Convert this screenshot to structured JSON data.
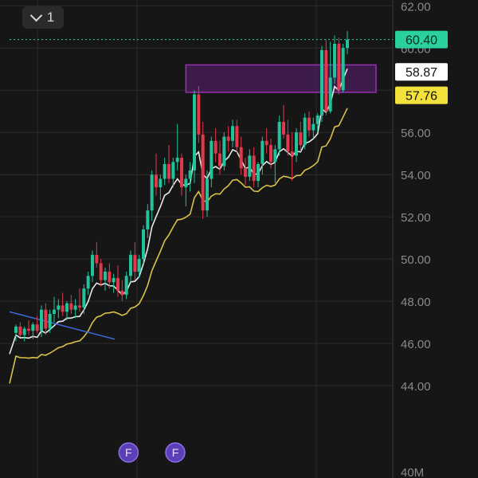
{
  "indicator_toggle": {
    "count": "1",
    "icon": "chevron-down-icon"
  },
  "colors": {
    "background": "#161616",
    "grid": "#2b2b2b",
    "up": "#22c39a",
    "down": "#e0394b",
    "ma_fast": "#e8e8e8",
    "ma_slow": "#d9c24a",
    "zone_fill": "#4a1d5c",
    "zone_border": "#9a2fb5",
    "trendline": "#3b6ad6",
    "price_line": "#2ad19c",
    "event_badge": "#5b3fb6"
  },
  "chart_data": {
    "type": "candlestick",
    "y_axis": {
      "position": "right",
      "ylim": [
        40,
        62.2
      ],
      "tick_labels": [
        "62.00",
        "60.00",
        "58.00",
        "56.00",
        "54.00",
        "52.00",
        "50.00",
        "48.00",
        "46.00",
        "44.00"
      ],
      "tick_values": [
        62,
        60,
        58,
        56,
        54,
        52,
        50,
        48,
        46,
        44
      ],
      "volume_label": "40M"
    },
    "last_price": {
      "value": 60.4,
      "label": "60.40"
    },
    "ma_fast_value": {
      "value": 58.87,
      "label": "58.87"
    },
    "ma_slow_value": {
      "value": 57.76,
      "label": "57.76"
    },
    "resistance_zone": {
      "from_index": 40,
      "to_index": 78,
      "low": 57.9,
      "high": 59.2
    },
    "trendline": {
      "from": [
        0,
        47.5
      ],
      "to": [
        12,
        46.2
      ]
    },
    "event_markers": [
      {
        "index": 25,
        "label": "F"
      },
      {
        "index": 36,
        "label": "F"
      }
    ],
    "candles": [
      [
        46.5,
        46.9,
        46.1,
        46.8
      ],
      [
        46.8,
        47.0,
        46.3,
        46.4
      ],
      [
        46.4,
        46.8,
        46.1,
        46.7
      ],
      [
        46.7,
        47.1,
        46.4,
        46.6
      ],
      [
        46.6,
        47.0,
        46.2,
        46.9
      ],
      [
        46.9,
        47.3,
        46.5,
        46.6
      ],
      [
        46.6,
        47.8,
        46.3,
        47.6
      ],
      [
        47.6,
        47.9,
        46.4,
        46.7
      ],
      [
        46.7,
        47.6,
        46.5,
        47.4
      ],
      [
        47.4,
        48.2,
        47.0,
        47.6
      ],
      [
        47.6,
        48.1,
        47.2,
        47.8
      ],
      [
        47.8,
        48.4,
        47.3,
        47.5
      ],
      [
        47.5,
        48.0,
        47.1,
        47.9
      ],
      [
        47.9,
        48.3,
        47.4,
        47.6
      ],
      [
        47.6,
        48.1,
        47.2,
        47.8
      ],
      [
        47.8,
        48.6,
        47.5,
        47.7
      ],
      [
        47.7,
        48.8,
        47.4,
        48.6
      ],
      [
        48.6,
        49.4,
        48.3,
        49.2
      ],
      [
        49.2,
        50.4,
        48.9,
        50.2
      ],
      [
        50.2,
        50.8,
        49.6,
        49.8
      ],
      [
        49.8,
        50.0,
        48.7,
        49.0
      ],
      [
        49.0,
        49.6,
        48.5,
        49.4
      ],
      [
        49.4,
        49.8,
        48.6,
        48.9
      ],
      [
        48.9,
        49.3,
        48.4,
        49.1
      ],
      [
        49.1,
        49.7,
        48.2,
        48.5
      ],
      [
        48.5,
        49.0,
        48.0,
        48.3
      ],
      [
        48.3,
        49.4,
        48.1,
        49.2
      ],
      [
        49.2,
        50.4,
        48.9,
        50.2
      ],
      [
        50.2,
        50.8,
        49.0,
        49.4
      ],
      [
        49.4,
        50.2,
        49.1,
        50.0
      ],
      [
        50.0,
        51.6,
        49.8,
        51.4
      ],
      [
        51.4,
        52.6,
        51.0,
        52.3
      ],
      [
        52.3,
        54.2,
        51.8,
        54.0
      ],
      [
        54.0,
        55.0,
        53.0,
        53.4
      ],
      [
        53.4,
        54.0,
        52.8,
        53.8
      ],
      [
        53.8,
        54.8,
        53.5,
        54.5
      ],
      [
        54.5,
        55.4,
        53.6,
        53.8
      ],
      [
        53.8,
        54.8,
        53.4,
        54.6
      ],
      [
        54.6,
        56.4,
        54.2,
        54.8
      ],
      [
        54.8,
        55.0,
        53.0,
        53.4
      ],
      [
        53.4,
        54.0,
        52.5,
        53.8
      ],
      [
        53.8,
        54.6,
        53.2,
        54.2
      ],
      [
        54.2,
        58.0,
        53.6,
        57.8
      ],
      [
        57.8,
        58.2,
        55.5,
        55.9
      ],
      [
        55.9,
        56.5,
        51.9,
        52.3
      ],
      [
        52.3,
        54.2,
        52.0,
        53.8
      ],
      [
        53.8,
        55.8,
        53.4,
        55.6
      ],
      [
        55.6,
        56.2,
        54.6,
        55.0
      ],
      [
        55.0,
        55.6,
        54.0,
        54.4
      ],
      [
        54.4,
        56.0,
        54.2,
        55.8
      ],
      [
        55.8,
        56.3,
        55.1,
        55.6
      ],
      [
        55.6,
        56.6,
        55.3,
        56.3
      ],
      [
        56.3,
        56.6,
        55.0,
        55.3
      ],
      [
        55.3,
        55.8,
        54.0,
        54.3
      ],
      [
        54.3,
        54.8,
        53.5,
        53.9
      ],
      [
        53.9,
        55.2,
        53.7,
        54.9
      ],
      [
        54.9,
        55.3,
        53.4,
        53.7
      ],
      [
        53.7,
        54.6,
        53.4,
        54.5
      ],
      [
        54.5,
        55.8,
        54.0,
        55.6
      ],
      [
        55.6,
        56.2,
        55.0,
        55.4
      ],
      [
        55.4,
        55.7,
        54.3,
        54.6
      ],
      [
        54.6,
        55.4,
        53.6,
        55.2
      ],
      [
        55.2,
        56.8,
        54.9,
        56.5
      ],
      [
        56.5,
        57.3,
        55.7,
        55.9
      ],
      [
        55.9,
        56.6,
        54.9,
        55.1
      ],
      [
        55.1,
        56.0,
        53.7,
        54.9
      ],
      [
        54.9,
        56.2,
        54.6,
        56.0
      ],
      [
        56.0,
        56.5,
        55.1,
        55.4
      ],
      [
        55.4,
        56.9,
        55.2,
        56.7
      ],
      [
        56.7,
        57.0,
        55.8,
        56.1
      ],
      [
        56.1,
        56.7,
        55.7,
        56.4
      ],
      [
        56.4,
        56.9,
        56.0,
        56.8
      ],
      [
        56.8,
        60.1,
        56.5,
        59.9
      ],
      [
        59.9,
        60.4,
        56.8,
        57.0
      ],
      [
        57.0,
        60.3,
        56.9,
        58.6
      ],
      [
        58.6,
        60.6,
        58.3,
        60.2
      ],
      [
        60.2,
        60.5,
        57.8,
        58.0
      ],
      [
        58.0,
        60.2,
        57.9,
        60.0
      ],
      [
        60.0,
        60.8,
        59.7,
        60.4
      ]
    ]
  }
}
